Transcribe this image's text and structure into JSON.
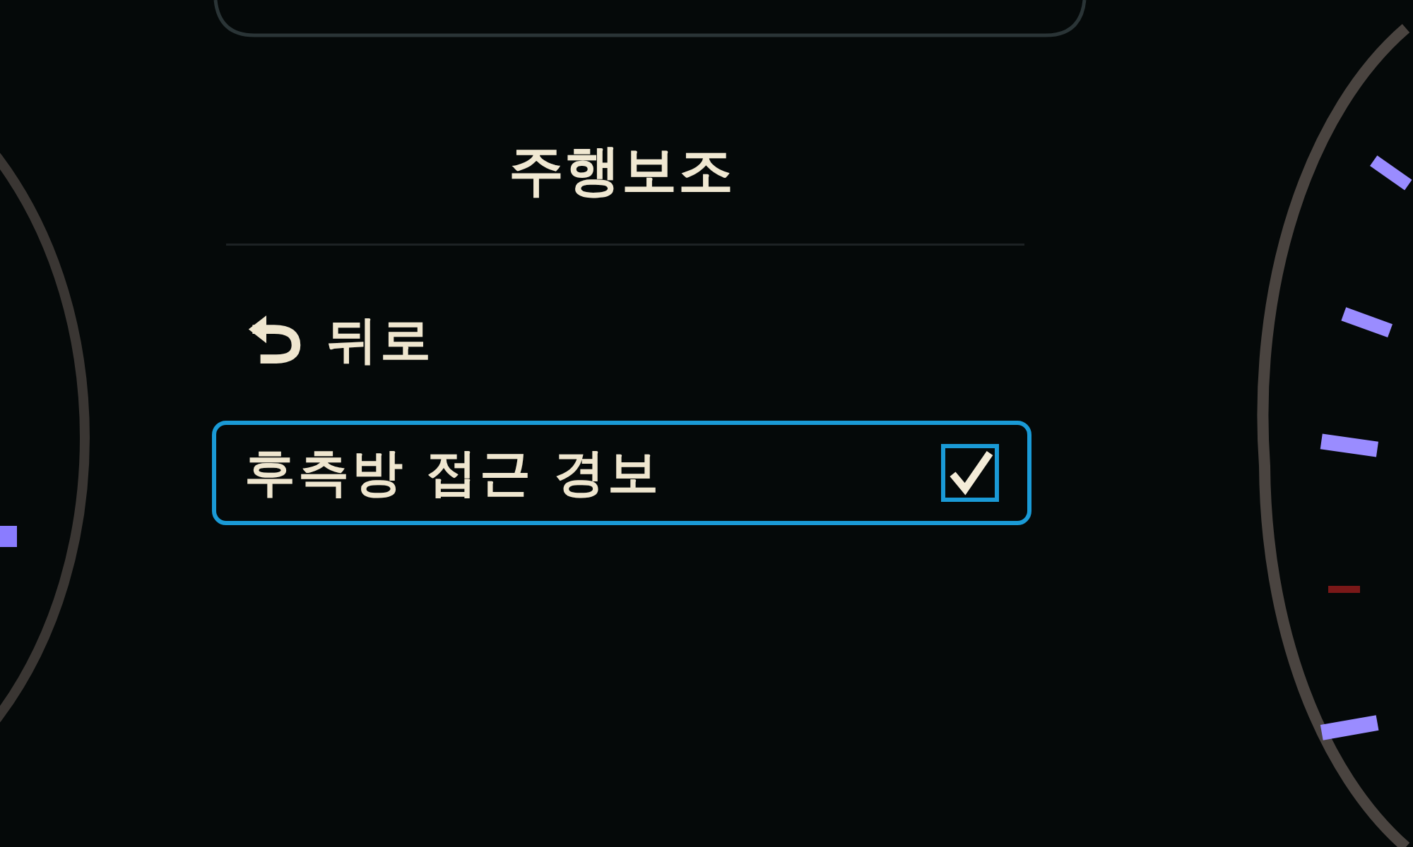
{
  "title": "주행보조",
  "menu": [
    {
      "kind": "back",
      "label": "뒤로",
      "selected": false
    },
    {
      "kind": "toggle",
      "label": "후측방 접근 경보",
      "selected": true,
      "checked": true
    }
  ]
}
